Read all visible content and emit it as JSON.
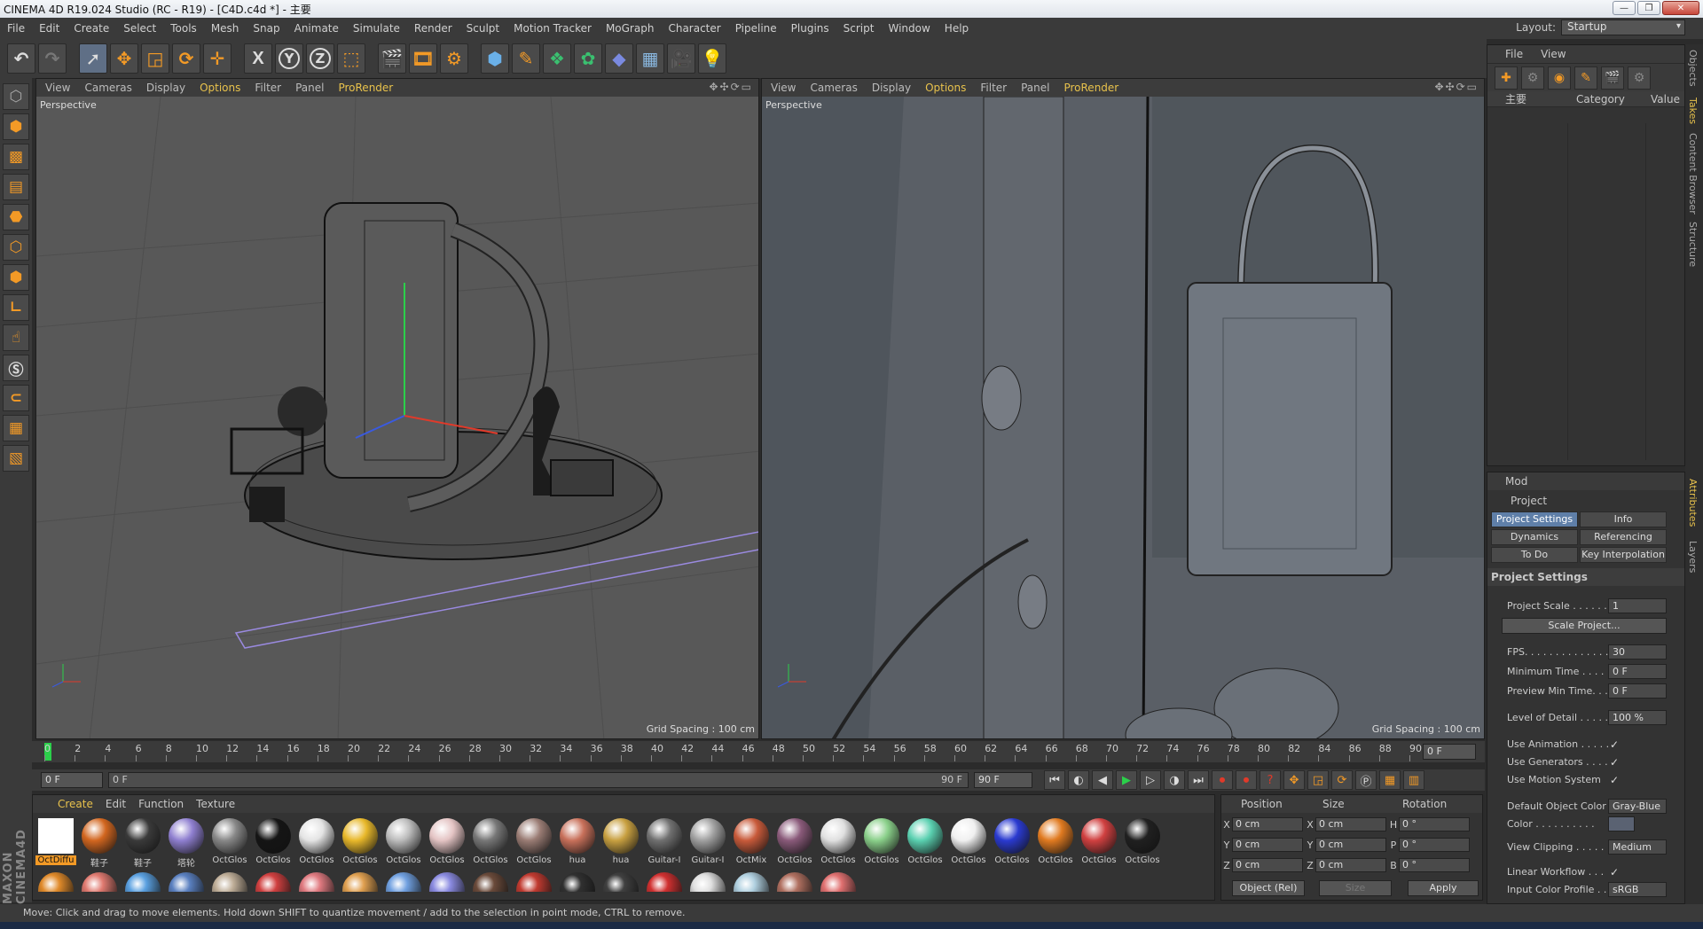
{
  "window": {
    "title": "CINEMA 4D R19.024 Studio (RC - R19) - [C4D.c4d *] - 主要"
  },
  "menu": [
    "File",
    "Edit",
    "Create",
    "Select",
    "Tools",
    "Mesh",
    "Snap",
    "Animate",
    "Simulate",
    "Render",
    "Sculpt",
    "Motion Tracker",
    "MoGraph",
    "Character",
    "Pipeline",
    "Plugins",
    "Script",
    "Window",
    "Help"
  ],
  "layout": {
    "label": "Layout:",
    "value": "Startup"
  },
  "toolbar": {
    "x": "X",
    "y": "Y",
    "z": "Z"
  },
  "viewport_menu": {
    "view": "View",
    "cameras": "Cameras",
    "display": "Display",
    "options": "Options",
    "filter": "Filter",
    "panel": "Panel",
    "prorender": "ProRender"
  },
  "viewport_left": {
    "label": "Perspective",
    "grid": "Grid Spacing : 100 cm"
  },
  "viewport_right": {
    "label": "Perspective",
    "grid": "Grid Spacing : 100 cm"
  },
  "timeline": {
    "ticks": [
      "0",
      "2",
      "4",
      "6",
      "8",
      "10",
      "12",
      "14",
      "16",
      "18",
      "20",
      "22",
      "24",
      "26",
      "28",
      "30",
      "32",
      "34",
      "36",
      "38",
      "40",
      "42",
      "44",
      "46",
      "48",
      "50",
      "52",
      "54",
      "56",
      "58",
      "60",
      "62",
      "64",
      "66",
      "68",
      "70",
      "72",
      "74",
      "76",
      "78",
      "80",
      "82",
      "84",
      "86",
      "88",
      "90"
    ],
    "current": "0 F",
    "start": "0 F",
    "slider_start": "0 F",
    "slider_end": "90 F",
    "end": "90 F"
  },
  "materials": {
    "menu": {
      "create": "Create",
      "edit": "Edit",
      "function": "Function",
      "texture": "Texture"
    },
    "items": [
      {
        "name": "OctDiffu",
        "color": "#ffffff"
      },
      {
        "name": "鞋子",
        "color": "#d2661f"
      },
      {
        "name": "鞋子",
        "color": "#3a3a3a"
      },
      {
        "name": "塔轮",
        "color": "#8f7fd0"
      },
      {
        "name": "OctGlos",
        "color": "#888888"
      },
      {
        "name": "OctGlos",
        "color": "#151515"
      },
      {
        "name": "OctGlos",
        "color": "#e4e4e4"
      },
      {
        "name": "OctGlos",
        "color": "#e8b82a"
      },
      {
        "name": "OctGlos",
        "color": "#bcbcbc"
      },
      {
        "name": "OctGlos",
        "color": "#e4c4c4"
      },
      {
        "name": "OctGlos",
        "color": "#777777"
      },
      {
        "name": "OctGlos",
        "color": "#9a7c74"
      },
      {
        "name": "hua",
        "color": "#c8705a"
      },
      {
        "name": "hua",
        "color": "#c8a040"
      },
      {
        "name": "Guitar-I",
        "color": "#707070"
      },
      {
        "name": "Guitar-I",
        "color": "#a0a0a0"
      },
      {
        "name": "OctMix",
        "color": "#c85a3a"
      },
      {
        "name": "OctGlos",
        "color": "#8a5a7a"
      },
      {
        "name": "OctGlos",
        "color": "#e0e0e0"
      },
      {
        "name": "OctGlos",
        "color": "#8ad08a"
      },
      {
        "name": "OctGlos",
        "color": "#5ad0b0"
      },
      {
        "name": "OctGlos",
        "color": "#f0f0f0"
      },
      {
        "name": "OctGlos",
        "color": "#2a3ad0"
      },
      {
        "name": "OctGlos",
        "color": "#e07a20"
      },
      {
        "name": "OctGlos",
        "color": "#d04040"
      },
      {
        "name": "OctGlos",
        "color": "#202020"
      }
    ],
    "row2_colors": [
      "#e08a2a",
      "#e07a70",
      "#5aa0e0",
      "#5a80c0",
      "#bfae98",
      "#d04040",
      "#e07a80",
      "#e0a050",
      "#70a0e0",
      "#8a8ae0",
      "#6a4a3a",
      "#c03a30",
      "#303030",
      "#404040",
      "#d03030",
      "#e0e0e0",
      "#b0d0e0",
      "#b07060",
      "#e07070"
    ]
  },
  "coordinates": {
    "position": "Position",
    "size": "Size",
    "rotation": "Rotation",
    "rows": [
      {
        "l1": "X",
        "v1": "0 cm",
        "l2": "X",
        "v2": "0 cm",
        "l3": "H",
        "v3": "0 °"
      },
      {
        "l1": "Y",
        "v1": "0 cm",
        "l2": "Y",
        "v2": "0 cm",
        "l3": "P",
        "v3": "0 °"
      },
      {
        "l1": "Z",
        "v1": "0 cm",
        "l2": "Z",
        "v2": "0 cm",
        "l3": "B",
        "v3": "0 °"
      }
    ],
    "mode": "Object (Rel)",
    "size_mode": "Size",
    "apply": "Apply"
  },
  "objects": {
    "menu": {
      "file": "File",
      "view": "View"
    },
    "cols": {
      "main": "主要",
      "category": "Category",
      "value": "Value"
    }
  },
  "attributes": {
    "menu": "Mod",
    "project": "Project",
    "tabs": [
      "Project Settings",
      "Info",
      "Dynamics",
      "Referencing",
      "To Do",
      "Key Interpolation"
    ],
    "section": "Project Settings",
    "project_scale_label": "Project Scale . . . . . .",
    "project_scale": "1",
    "scale_btn": "Scale Project...",
    "fps_label": "FPS. . . . . . . . . . . . . .",
    "fps": "30",
    "min_time_label": "Minimum Time . . . . .",
    "min_time": "0 F",
    "preview_min_label": "Preview Min Time. . .",
    "preview_min": "0 F",
    "lod_label": "Level of Detail . . . . .",
    "lod": "100 %",
    "use_anim": "Use Animation . . . . .",
    "use_gen": "Use Generators . . . .",
    "use_motion": "Use Motion System",
    "check": "✓",
    "def_color_label": "Default Object Color",
    "def_color": "Gray-Blue",
    "color_label": "Color . . . . . . . . . .",
    "clipping_label": "View Clipping . . . . .",
    "clipping": "Medium",
    "linear_label": "Linear Workflow . . .",
    "input_profile_label": "Input Color Profile . .",
    "input_profile": "sRGB"
  },
  "sidetabs": [
    "Objects",
    "Takes",
    "Content Browser",
    "Structure",
    "Attributes",
    "Layers"
  ],
  "status": "Move: Click and drag to move elements. Hold down SHIFT to quantize movement / add to the selection in point mode, CTRL to remove."
}
